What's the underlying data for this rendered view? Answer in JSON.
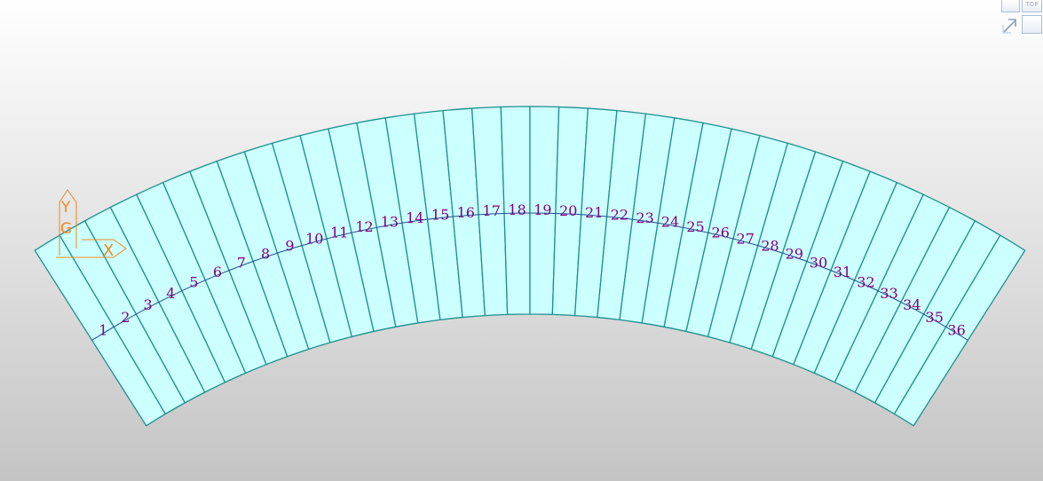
{
  "viewport": {
    "background_top": "#ffffff",
    "background_bottom": "#c4c4c4"
  },
  "model": {
    "segment_count": 36,
    "segment_labels": [
      "1",
      "2",
      "3",
      "4",
      "5",
      "6",
      "7",
      "8",
      "9",
      "10",
      "11",
      "12",
      "13",
      "14",
      "15",
      "16",
      "17",
      "18",
      "19",
      "20",
      "21",
      "22",
      "23",
      "24",
      "25",
      "26",
      "27",
      "28",
      "29",
      "30",
      "31",
      "32",
      "33",
      "34",
      "35",
      "36"
    ],
    "fill_color": "#ccffff",
    "edge_color": "#1f8f8f",
    "label_color": "#800080"
  },
  "ucs_icon": {
    "y_label": "Y",
    "x_label": "X",
    "origin_label": "G",
    "color": "#ee8820"
  },
  "viewcube": {
    "top_label": "TOP",
    "icon": "rotate-arrow-icon"
  }
}
